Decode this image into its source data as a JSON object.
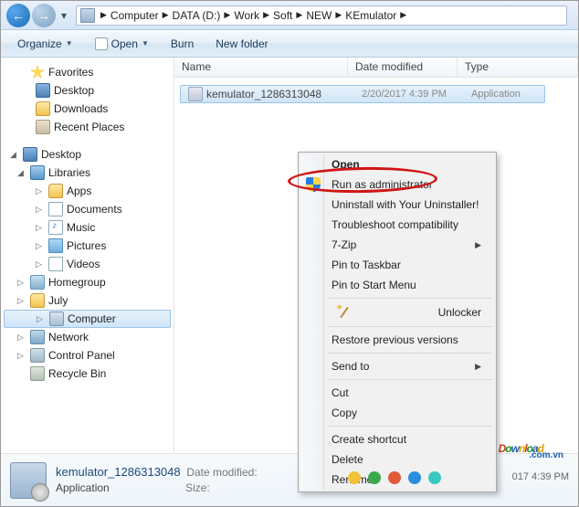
{
  "breadcrumb": [
    "Computer",
    "DATA (D:)",
    "Work",
    "Soft",
    "NEW",
    "KEmulator"
  ],
  "toolbar": {
    "organize": "Organize",
    "open": "Open",
    "burn": "Burn",
    "newfolder": "New folder"
  },
  "columns": {
    "name": "Name",
    "date": "Date modified",
    "type": "Type"
  },
  "nav": {
    "favorites": "Favorites",
    "fav_items": [
      "Desktop",
      "Downloads",
      "Recent Places"
    ],
    "desktop": "Desktop",
    "libraries": "Libraries",
    "lib_items": [
      "Apps",
      "Documents",
      "Music",
      "Pictures",
      "Videos"
    ],
    "other": [
      "Homegroup",
      "July",
      "Computer",
      "Network",
      "Control Panel",
      "Recycle Bin"
    ]
  },
  "file": {
    "name": "kemulator_1286313048",
    "date": "2/20/2017 4:39 PM",
    "type": "Application"
  },
  "context": {
    "open": "Open",
    "runas": "Run as administrator",
    "uninstall": "Uninstall with Your Uninstaller!",
    "troubleshoot": "Troubleshoot compatibility",
    "sevenzip": "7-Zip",
    "pin_taskbar": "Pin to Taskbar",
    "pin_start": "Pin to Start Menu",
    "unlocker": "Unlocker",
    "restore": "Restore previous versions",
    "sendto": "Send to",
    "cut": "Cut",
    "copy": "Copy",
    "shortcut": "Create shortcut",
    "delete": "Delete",
    "rename": "Rename"
  },
  "details": {
    "name": "kemulator_1286313048",
    "type": "Application",
    "dm_label": "Date modified:",
    "size_label": "Size:"
  },
  "bottom_right": "017 4:39 PM",
  "watermark": {
    "text": "Download",
    "suffix": ".com.vn"
  },
  "dot_colors": [
    "#f2c23a",
    "#3aa84a",
    "#e05a3a",
    "#2a8de0",
    "#3ac8c0"
  ]
}
